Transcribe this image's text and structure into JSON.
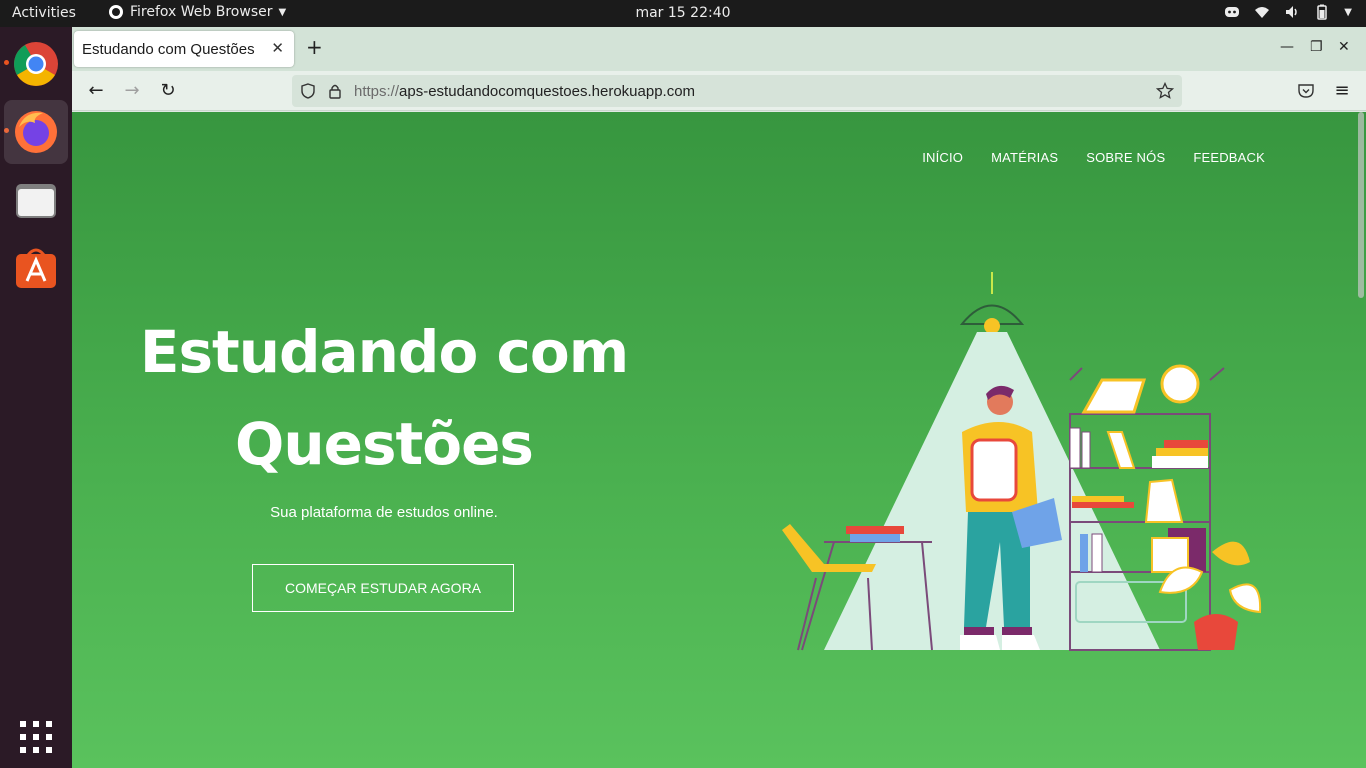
{
  "topbar": {
    "activities": "Activities",
    "app_name": "Firefox Web Browser",
    "clock": "mar 15  22:40"
  },
  "dock": {
    "apps": [
      "chrome-icon",
      "firefox-icon",
      "files-icon",
      "software-icon"
    ],
    "grid": "show-applications-icon"
  },
  "browser": {
    "tab_title": "Estudando com Questões",
    "url_scheme": "https://",
    "url_host": "aps-estudandocomquestoes.herokuapp.com"
  },
  "site": {
    "nav": [
      "INÍCIO",
      "MATÉRIAS",
      "SOBRE NÓS",
      "FEEDBACK"
    ],
    "hero_title_line1": "Estudando com",
    "hero_title_line2": "Questões",
    "hero_subtitle": "Sua plataforma de estudos online.",
    "cta_label": "COMEÇAR ESTUDAR AGORA"
  },
  "colors": {
    "page_green": "#3f9f45",
    "topbar": "#1b1b1b",
    "dock": "#2b1a26",
    "accent_orange": "#e95420"
  }
}
